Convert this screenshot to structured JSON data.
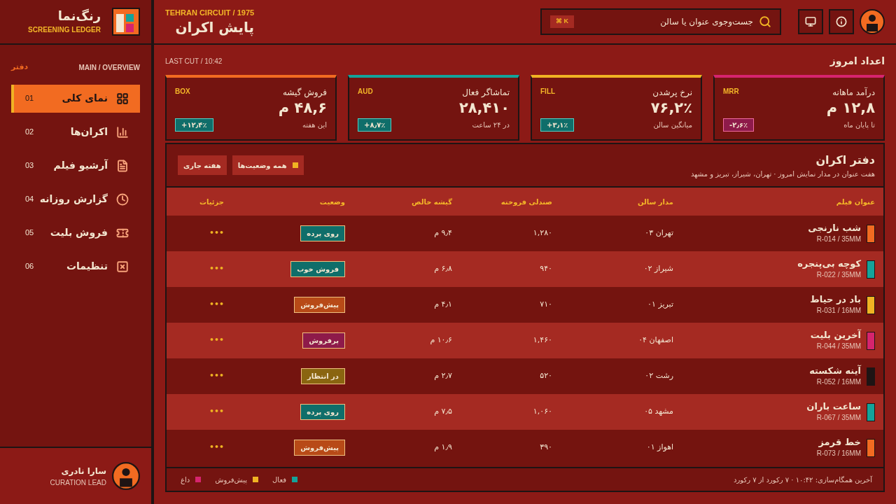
{
  "brand": {
    "name": "رنگ‌نما",
    "subtitle": "SCREENING LEDGER"
  },
  "header": {
    "eyebrow": "TEHRAN CIRCUIT / 1975",
    "title": "پایش اکران",
    "search": {
      "placeholder": "جست‌وجوی عنوان یا سالن",
      "shortcut": "⌘ K"
    }
  },
  "sidebar": {
    "section": "MAIN / OVERVIEW",
    "tag": "دفتر",
    "items": [
      {
        "num": "01",
        "label": "نمای کلی",
        "kind": "grid",
        "selected": true
      },
      {
        "num": "02",
        "label": "اکران‌ها",
        "kind": "chart",
        "selected": false
      },
      {
        "num": "03",
        "label": "آرشیو فیلم",
        "kind": "doc",
        "selected": false
      },
      {
        "num": "04",
        "label": "گزارش روزانه",
        "kind": "clock",
        "selected": false
      },
      {
        "num": "05",
        "label": "فروش بلیت",
        "kind": "ticket",
        "selected": false
      },
      {
        "num": "06",
        "label": "تنظیمات",
        "kind": "cross",
        "selected": false
      }
    ],
    "user": {
      "name": "سارا نادری",
      "role": "CURATION LEAD"
    }
  },
  "overview": {
    "title": "اعداد امروز",
    "last_cut": "LAST CUT / 10:42"
  },
  "kpis": [
    {
      "title": "درآمد ماهانه",
      "code": "MRR",
      "value": "۱۲,۸ م",
      "sub": "تا پایان ماه",
      "delta": "-۲٫۶٪",
      "kind": "down",
      "color": "#d6246e"
    },
    {
      "title": "نرخ پرشدن",
      "code": "FILL",
      "value": "۷۶,۲٪",
      "sub": "میانگین سالن",
      "delta": "+۳٫۱٪",
      "kind": "up",
      "color": "#f0b323"
    },
    {
      "title": "تماشاگر فعال",
      "code": "AUD",
      "value": "۲۸,۴۱۰",
      "sub": "در ۲۴ ساعت",
      "delta": "+۸٫۷٪",
      "kind": "up",
      "color": "#14a39a"
    },
    {
      "title": "فروش گیشه",
      "code": "BOX",
      "value": "۴۸,۶ م",
      "sub": "این هفته",
      "delta": "+۱۲٫۴٪",
      "kind": "up",
      "color": "#f26b21"
    }
  ],
  "ledger": {
    "title": "دفتر اکران",
    "subtitle": "هفت عنوان در مدار نمایش امروز · تهران، شیراز، تبریز و مشهد",
    "filters": [
      {
        "label": "همه وضعیت‌ها",
        "kind": "status"
      },
      {
        "label": "هفته جاری",
        "kind": "plain"
      }
    ],
    "columns": [
      "عنوان فیلم",
      "مدار سالن",
      "صندلی فروخته",
      "گیشه خالص",
      "وضعیت",
      "جزئیات"
    ],
    "rows": [
      {
        "title": "شب نارنجی",
        "code": "R-014 / 35MM",
        "color": "#f26b21",
        "hall": "تهران ۰۳",
        "seats": "۱,۲۸۰",
        "gross": "۹٫۴ م",
        "status": {
          "label": "روی پرده",
          "color": "#0f6e6a"
        },
        "details": "•••"
      },
      {
        "title": "کوچه بی‌پنجره",
        "code": "R-022 / 35MM",
        "color": "#14a39a",
        "hall": "شیراز ۰۲",
        "seats": "۹۴۰",
        "gross": "۶٫۸ م",
        "status": {
          "label": "فروش خوب",
          "color": "#0f6e6a"
        },
        "details": "•••"
      },
      {
        "title": "باد در حیاط",
        "code": "R-031 / 16MM",
        "color": "#f0b323",
        "hall": "تبریز ۰۱",
        "seats": "۷۱۰",
        "gross": "۴٫۱ م",
        "status": {
          "label": "پیش‌فروش",
          "color": "#b84a17"
        },
        "details": "•••"
      },
      {
        "title": "آخرین بلیت",
        "code": "R-044 / 35MM",
        "color": "#d6246e",
        "hall": "اصفهان ۰۴",
        "seats": "۱,۴۶۰",
        "gross": "۱۰٫۶ م",
        "status": {
          "label": "پرفروش",
          "color": "#8e1a4a"
        },
        "details": "•••"
      },
      {
        "title": "آینه شکسته",
        "code": "R-052 / 16MM",
        "color": "#1e1414",
        "hall": "رشت ۰۲",
        "seats": "۵۲۰",
        "gross": "۲٫۷ م",
        "status": {
          "label": "در انتظار",
          "color": "#8a6510"
        },
        "details": "•••"
      },
      {
        "title": "ساعت باران",
        "code": "R-067 / 35MM",
        "color": "#14a39a",
        "hall": "مشهد ۰۵",
        "seats": "۱,۰۶۰",
        "gross": "۷٫۵ م",
        "status": {
          "label": "روی پرده",
          "color": "#0f6e6a"
        },
        "details": "•••"
      },
      {
        "title": "خط قرمز",
        "code": "R-073 / 16MM",
        "color": "#f26b21",
        "hall": "اهواز ۰۱",
        "seats": "۳۹۰",
        "gross": "۱٫۹ م",
        "status": {
          "label": "پیش‌فروش",
          "color": "#b84a17"
        },
        "details": "•••"
      }
    ]
  },
  "footer": {
    "sync": "آخرین همگام‌سازی: ۱۰:۴۲ · ۷ رکورد از ۷ رکورد",
    "legend": [
      {
        "label": "فعال",
        "color": "#14a39a"
      },
      {
        "label": "پیش‌فروش",
        "color": "#f0b323"
      },
      {
        "label": "داغ",
        "color": "#d6246e"
      }
    ]
  }
}
